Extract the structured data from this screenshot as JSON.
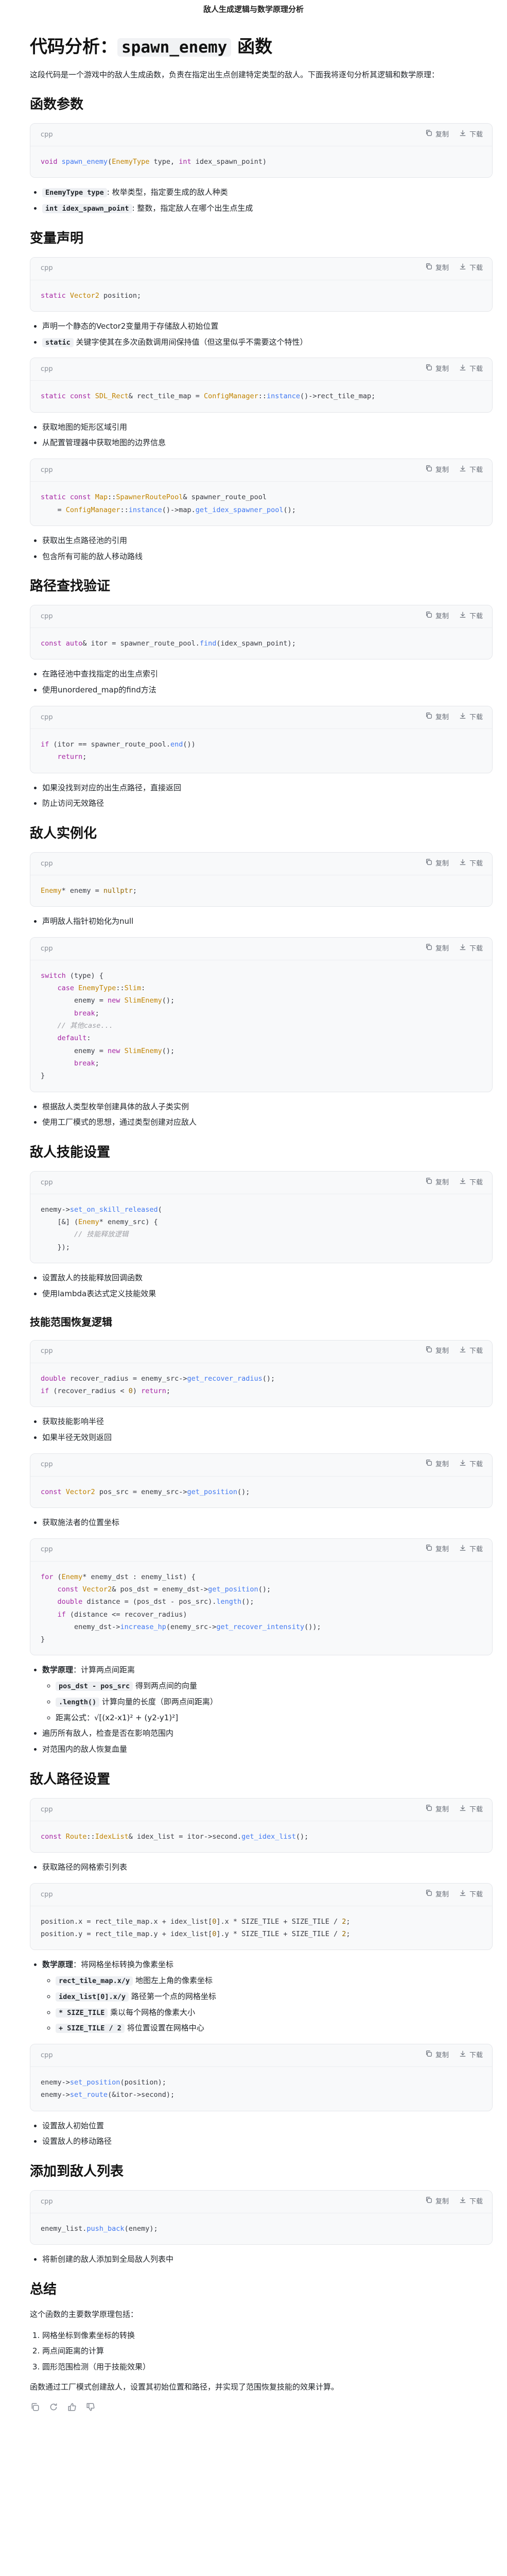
{
  "window": {
    "title": "敌人生成逻辑与数学原理分析"
  },
  "doc": {
    "title_prefix": "代码分析：",
    "title_code": "spawn_enemy",
    "title_suffix": " 函数",
    "intro": "这段代码是一个游戏中的敌人生成函数，负责在指定出生点创建特定类型的敌人。下面我将逐句分析其逻辑和数学原理：",
    "code_ui": {
      "lang": "cpp",
      "copy": "复制",
      "download": "下载"
    },
    "sections": [
      {
        "heading": "函数参数",
        "blocks": [
          {
            "type": "code",
            "lines": [
              "void spawn_enemy(EnemyType type, int idex_spawn_point)"
            ]
          },
          {
            "type": "list",
            "items": [
              {
                "code": "EnemyType type",
                "text": ": 枚举类型，指定要生成的敌人种类"
              },
              {
                "code": "int idex_spawn_point",
                "text": ": 整数，指定敌人在哪个出生点生成"
              }
            ]
          }
        ]
      },
      {
        "heading": "变量声明",
        "blocks": [
          {
            "type": "code",
            "lines": [
              "static Vector2 position;"
            ]
          },
          {
            "type": "list",
            "items": [
              {
                "text": "声明一个静态的Vector2变量用于存储敌人初始位置"
              },
              {
                "code": "static",
                "text": " 关键字使其在多次函数调用间保持值（但这里似乎不需要这个特性）"
              }
            ]
          },
          {
            "type": "code",
            "lines": [
              "static const SDL_Rect& rect_tile_map = ConfigManager::instance()->rect_tile_map;"
            ]
          },
          {
            "type": "list",
            "items": [
              {
                "text": "获取地图的矩形区域引用"
              },
              {
                "text": "从配置管理器中获取地图的边界信息"
              }
            ]
          },
          {
            "type": "code",
            "lines": [
              "static const Map::SpawnerRoutePool& spawner_route_pool",
              "    = ConfigManager::instance()->map.get_idex_spawner_pool();"
            ]
          },
          {
            "type": "list",
            "items": [
              {
                "text": "获取出生点路径池的引用"
              },
              {
                "text": "包含所有可能的敌人移动路线"
              }
            ]
          }
        ]
      },
      {
        "heading": "路径查找验证",
        "blocks": [
          {
            "type": "code",
            "lines": [
              "const auto& itor = spawner_route_pool.find(idex_spawn_point);"
            ]
          },
          {
            "type": "list",
            "items": [
              {
                "text": "在路径池中查找指定的出生点索引"
              },
              {
                "text": "使用unordered_map的find方法"
              }
            ]
          },
          {
            "type": "code",
            "lines": [
              "if (itor == spawner_route_pool.end())",
              "    return;"
            ]
          },
          {
            "type": "list",
            "items": [
              {
                "text": "如果没找到对应的出生点路径，直接返回"
              },
              {
                "text": "防止访问无效路径"
              }
            ]
          }
        ]
      },
      {
        "heading": "敌人实例化",
        "blocks": [
          {
            "type": "code",
            "lines": [
              "Enemy* enemy = nullptr;"
            ]
          },
          {
            "type": "list",
            "items": [
              {
                "text": "声明敌人指针初始化为null"
              }
            ]
          },
          {
            "type": "code",
            "lines": [
              "switch (type) {",
              "    case EnemyType::Slim:",
              "        enemy = new SlimEnemy();",
              "        break;",
              "    // 其他case...",
              "    default:",
              "        enemy = new SlimEnemy();",
              "        break;",
              "}"
            ]
          },
          {
            "type": "list",
            "items": [
              {
                "text": "根据敌人类型枚举创建具体的敌人子类实例"
              },
              {
                "text": "使用工厂模式的思想，通过类型创建对应敌人"
              }
            ]
          }
        ]
      },
      {
        "heading": "敌人技能设置",
        "blocks": [
          {
            "type": "code",
            "lines": [
              "enemy->set_on_skill_released(",
              "    [&] (Enemy* enemy_src) {",
              "        // 技能释放逻辑",
              "    });"
            ]
          },
          {
            "type": "list",
            "items": [
              {
                "text": "设置敌人的技能释放回调函数"
              },
              {
                "text": "使用lambda表达式定义技能效果"
              }
            ]
          },
          {
            "type": "subheading",
            "text": "技能范围恢复逻辑"
          },
          {
            "type": "code",
            "lines": [
              "double recover_radius = enemy_src->get_recover_radius();",
              "if (recover_radius < 0) return;"
            ]
          },
          {
            "type": "list",
            "items": [
              {
                "text": "获取技能影响半径"
              },
              {
                "text": "如果半径无效则返回"
              }
            ]
          },
          {
            "type": "code",
            "lines": [
              "const Vector2 pos_src = enemy_src->get_position();"
            ]
          },
          {
            "type": "list",
            "items": [
              {
                "text": "获取施法者的位置坐标"
              }
            ]
          },
          {
            "type": "code",
            "lines": [
              "for (Enemy* enemy_dst : enemy_list) {",
              "    const Vector2& pos_dst = enemy_dst->get_position();",
              "    double distance = (pos_dst - pos_src).length();",
              "    if (distance <= recover_radius)",
              "        enemy_dst->increase_hp(enemy_src->get_recover_intensity());",
              "}"
            ]
          },
          {
            "type": "list",
            "items": [
              {
                "bold": "数学原理",
                "text": "：计算两点间距离",
                "sub": [
                  {
                    "code": "pos_dst - pos_src",
                    "text": " 得到两点间的向量"
                  },
                  {
                    "code": ".length()",
                    "text": " 计算向量的长度（即两点间距离）"
                  },
                  {
                    "text": "距离公式：√[(x2-x1)² + (y2-y1)²]"
                  }
                ]
              },
              {
                "text": "遍历所有敌人，检查是否在影响范围内"
              },
              {
                "text": "对范围内的敌人恢复血量"
              }
            ]
          }
        ]
      },
      {
        "heading": "敌人路径设置",
        "blocks": [
          {
            "type": "code",
            "lines": [
              "const Route::IdexList& idex_list = itor->second.get_idex_list();"
            ]
          },
          {
            "type": "list",
            "items": [
              {
                "text": "获取路径的网格索引列表"
              }
            ]
          },
          {
            "type": "code",
            "lines": [
              "position.x = rect_tile_map.x + idex_list[0].x * SIZE_TILE + SIZE_TILE / 2;",
              "position.y = rect_tile_map.y + idex_list[0].y * SIZE_TILE + SIZE_TILE / 2;"
            ]
          },
          {
            "type": "list",
            "items": [
              {
                "bold": "数学原理",
                "text": "：将网格坐标转换为像素坐标",
                "sub": [
                  {
                    "code": "rect_tile_map.x/y",
                    "text": " 地图左上角的像素坐标"
                  },
                  {
                    "code": "idex_list[0].x/y",
                    "text": " 路径第一个点的网格坐标"
                  },
                  {
                    "code": "* SIZE_TILE",
                    "text": " 乘以每个网格的像素大小"
                  },
                  {
                    "code": "+ SIZE_TILE / 2",
                    "text": " 将位置设置在网格中心"
                  }
                ]
              }
            ]
          },
          {
            "type": "code",
            "lines": [
              "enemy->set_position(position);",
              "enemy->set_route(&itor->second);"
            ]
          },
          {
            "type": "list",
            "items": [
              {
                "text": "设置敌人初始位置"
              },
              {
                "text": "设置敌人的移动路径"
              }
            ]
          }
        ]
      },
      {
        "heading": "添加到敌人列表",
        "blocks": [
          {
            "type": "code",
            "lines": [
              "enemy_list.push_back(enemy);"
            ]
          },
          {
            "type": "list",
            "items": [
              {
                "text": "将新创建的敌人添加到全局敌人列表中"
              }
            ]
          }
        ]
      },
      {
        "heading": "总结",
        "blocks": [
          {
            "type": "para",
            "text": "这个函数的主要数学原理包括："
          },
          {
            "type": "olist",
            "items": [
              {
                "text": "网格坐标到像素坐标的转换"
              },
              {
                "text": "两点间距离的计算"
              },
              {
                "text": "圆形范围检测（用于技能效果）"
              }
            ]
          },
          {
            "type": "para",
            "text": "函数通过工厂模式创建敌人，设置其初始位置和路径，并实现了范围恢复技能的效果计算。"
          }
        ]
      }
    ]
  },
  "footer_icons": [
    "copy-icon",
    "refresh-icon",
    "thumbs-up-icon",
    "thumbs-down-icon"
  ],
  "colors": {
    "keyword": "#a626a4",
    "function": "#4078f2",
    "type": "#c18401",
    "comment": "#a0a1a7",
    "number": "#986801",
    "text": "#383a42"
  }
}
